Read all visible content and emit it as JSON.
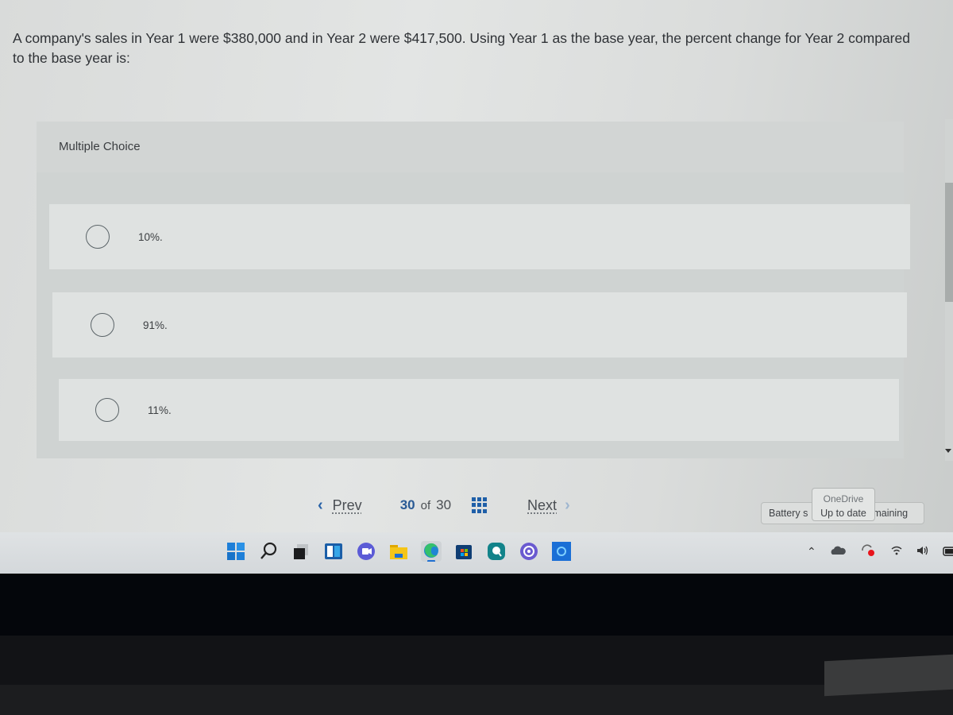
{
  "question": {
    "text": "A company's sales in Year 1 were $380,000 and in Year 2 were $417,500. Using Year 1 as the base year, the percent change for Year 2 compared to the base year is:"
  },
  "multiple_choice": {
    "title": "Multiple Choice",
    "options": [
      {
        "label": "10%.",
        "selected": false
      },
      {
        "label": "91%.",
        "selected": false
      },
      {
        "label": "11%.",
        "selected": false
      }
    ]
  },
  "navigation": {
    "prev_label": "Prev",
    "next_label": "Next",
    "current_page": "30",
    "of_label": "of",
    "total_pages": "30",
    "grid_icon": "question-grid-icon"
  },
  "tooltips": {
    "battery_text_left": "Battery s",
    "battery_text_right": "maining",
    "onedrive_title": "OneDrive",
    "onedrive_status": "Up to date"
  },
  "taskbar": {
    "apps": [
      {
        "name": "start",
        "icon": "windows-start-icon"
      },
      {
        "name": "search",
        "icon": "search-icon"
      },
      {
        "name": "task-view",
        "icon": "task-view-icon"
      },
      {
        "name": "widgets",
        "icon": "widgets-icon"
      },
      {
        "name": "teams-chat",
        "icon": "chat-icon"
      },
      {
        "name": "file-explorer",
        "icon": "folder-icon"
      },
      {
        "name": "edge",
        "icon": "edge-icon",
        "active": true
      },
      {
        "name": "store",
        "icon": "store-icon"
      },
      {
        "name": "app-teal",
        "icon": "teal-app-icon"
      },
      {
        "name": "app-purple",
        "icon": "purple-app-icon"
      },
      {
        "name": "cortana",
        "icon": "cortana-icon"
      }
    ],
    "tray": [
      "chevron-up-icon",
      "onedrive-cloud-icon",
      "sync-icon",
      "wifi-icon",
      "volume-icon",
      "battery-icon"
    ]
  },
  "colors": {
    "accent": "#1f5fa8",
    "page_background": "#dcdedd"
  }
}
